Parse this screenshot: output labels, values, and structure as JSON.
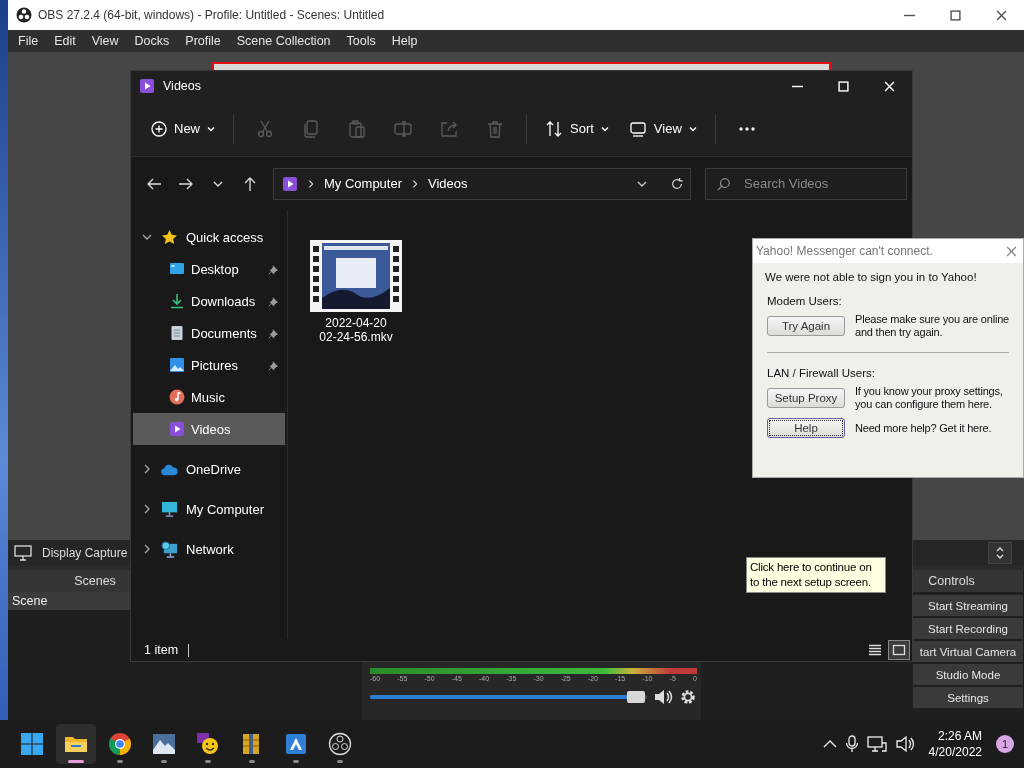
{
  "obs": {
    "title": "OBS 27.2.4 (64-bit, windows) - Profile: Untitled - Scenes: Untitled",
    "menu": [
      "File",
      "Edit",
      "View",
      "Docks",
      "Profile",
      "Scene Collection",
      "Tools",
      "Help"
    ],
    "source_label": "Display Capture",
    "scenes_header": "Scenes",
    "scenes": [
      {
        "label": "Scene",
        "selected": true
      }
    ],
    "meter_scale": [
      "-60",
      "-55",
      "-50",
      "-45",
      "-40",
      "-35",
      "-30",
      "-25",
      "-20",
      "-15",
      "-10",
      "-5",
      "0"
    ],
    "volume": {
      "level": 0.96
    },
    "controls_header": "Controls",
    "controls": [
      "Start Streaming",
      "Start Recording",
      "tart Virtual Camera",
      "Studio Mode",
      "Settings"
    ]
  },
  "explorer": {
    "title": "Videos",
    "new_label": "New",
    "tools": [
      {
        "kind": "cut",
        "disabled": true
      },
      {
        "kind": "copy",
        "disabled": true
      },
      {
        "kind": "paste",
        "disabled": true
      },
      {
        "kind": "rename",
        "disabled": true
      },
      {
        "kind": "share",
        "disabled": true
      },
      {
        "kind": "delete",
        "disabled": true
      }
    ],
    "sort_label": "Sort",
    "view_label": "View",
    "path": [
      "My Computer",
      "Videos"
    ],
    "search": {
      "placeholder": "Search Videos"
    },
    "nav": [
      {
        "label": "Quick access",
        "kind": "star",
        "expanded": true,
        "selected": false,
        "children": [
          {
            "label": "Desktop",
            "kind": "desktop",
            "pinned": true,
            "selected": false
          },
          {
            "label": "Downloads",
            "kind": "downloads",
            "pinned": true,
            "selected": false
          },
          {
            "label": "Documents",
            "kind": "documents",
            "pinned": true,
            "selected": false
          },
          {
            "label": "Pictures",
            "kind": "pictures",
            "pinned": true,
            "selected": false
          },
          {
            "label": "Music",
            "kind": "music",
            "pinned": false,
            "selected": false
          },
          {
            "label": "Videos",
            "kind": "videos",
            "pinned": false,
            "selected": true
          }
        ]
      },
      {
        "label": "OneDrive",
        "kind": "cloud",
        "expanded": false,
        "selected": false
      },
      {
        "label": "My Computer",
        "kind": "computer",
        "expanded": false,
        "selected": false
      },
      {
        "label": "Network",
        "kind": "network",
        "expanded": false,
        "selected": false
      }
    ],
    "files": [
      {
        "name": "2022-04-20 02-24-56.mkv"
      }
    ],
    "status": "1 item",
    "views": [
      {
        "kind": "details",
        "selected": false
      },
      {
        "kind": "large",
        "selected": true
      }
    ]
  },
  "dialog": {
    "title": "Yahoo! Messenger can't connect.",
    "message": "We were not able to sign you in to Yahoo!",
    "sections": [
      {
        "heading": "Modem Users:",
        "rows": [
          {
            "button": "Try Again",
            "focused": false,
            "text": "Please make sure you are online and then try again."
          }
        ]
      },
      {
        "heading": "LAN / Firewall Users:",
        "rows": [
          {
            "button": "Setup Proxy",
            "focused": false,
            "text": "If you know your proxy settings, you can configure them here."
          },
          {
            "button": "Help",
            "focused": true,
            "text": "Need more help? Get it here."
          }
        ]
      }
    ]
  },
  "tooltip": {
    "text": "Click here to continue on to the next setup screen."
  },
  "taskbar": {
    "apps": [
      {
        "kind": "explorer",
        "selected": true
      },
      {
        "kind": "chrome",
        "selected": false
      },
      {
        "kind": "photo",
        "selected": false
      },
      {
        "kind": "yahoo",
        "selected": false
      },
      {
        "kind": "archive",
        "selected": false
      },
      {
        "kind": "paint",
        "selected": false
      },
      {
        "kind": "obs",
        "selected": false
      }
    ],
    "time": "2:26 AM",
    "date": "4/20/2022",
    "badge": "1"
  }
}
